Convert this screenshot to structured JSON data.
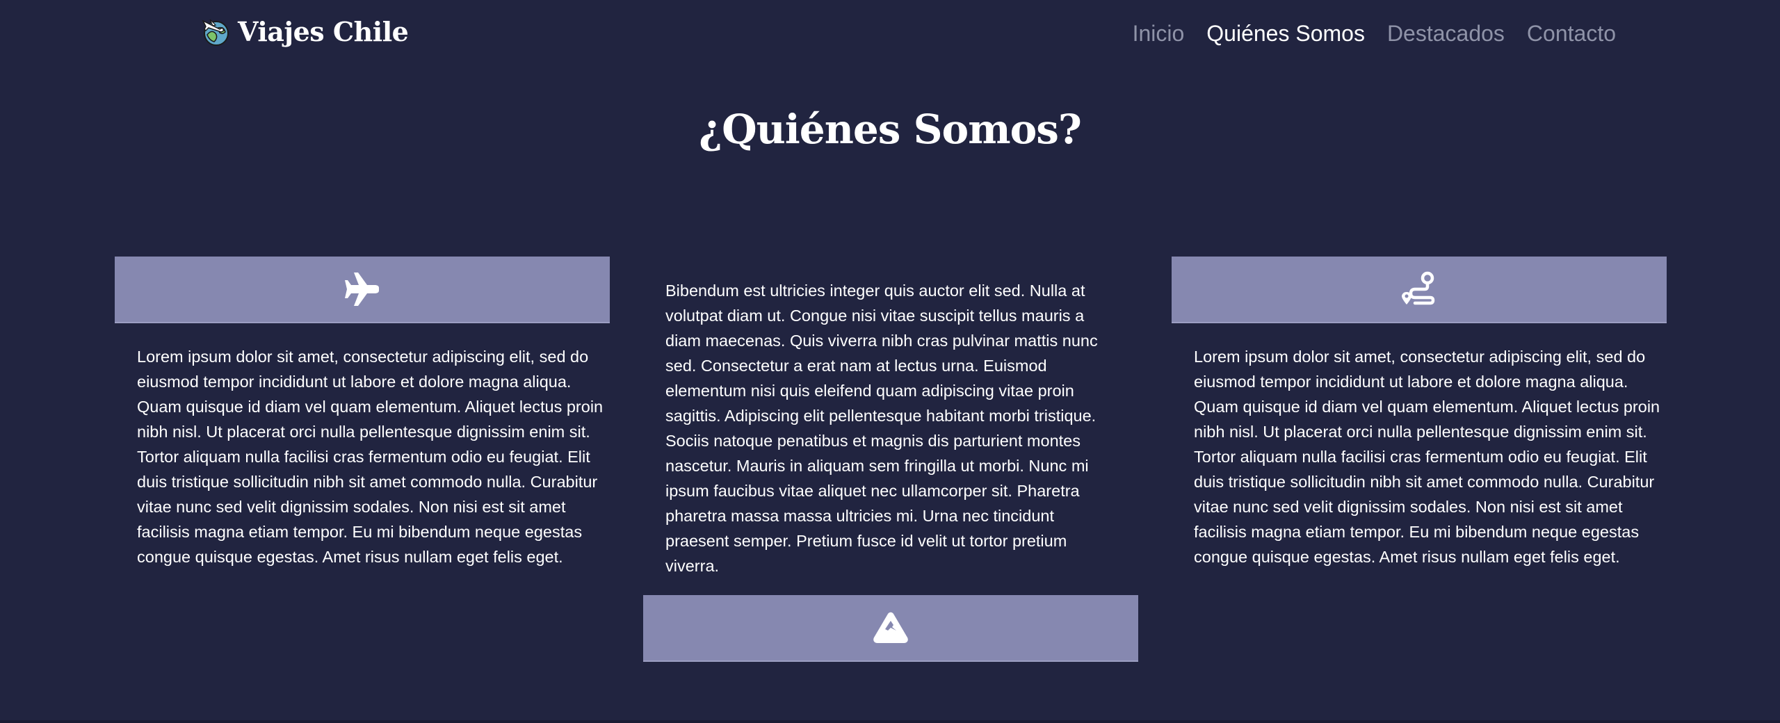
{
  "nav": {
    "brand": "Viajes Chile",
    "links": [
      {
        "label": "Inicio",
        "active": false
      },
      {
        "label": "Quiénes Somos",
        "active": true
      },
      {
        "label": "Destacados",
        "active": false
      },
      {
        "label": "Contacto",
        "active": false
      }
    ]
  },
  "section": {
    "title": "¿Quiénes Somos?"
  },
  "cards": {
    "left": {
      "icon": "airplane-icon",
      "text": "Lorem ipsum dolor sit amet, consectetur adipiscing elit, sed do eiusmod tempor incididunt ut labore et dolore magna aliqua. Quam quisque id diam vel quam elementum. Aliquet lectus proin nibh nisl. Ut placerat orci nulla pellentesque dignissim enim sit. Tortor aliquam nulla facilisi cras fermentum odio eu feugiat. Elit duis tristique sollicitudin nibh sit amet commodo nulla. Curabitur vitae nunc sed velit dignissim sodales. Non nisi est sit amet facilisis magna etiam tempor. Eu mi bibendum neque egestas congue quisque egestas. Amet risus nullam eget felis eget."
    },
    "middle": {
      "icon": "mountain-icon",
      "text": "Bibendum est ultricies integer quis auctor elit sed. Nulla at volutpat diam ut. Congue nisi vitae suscipit tellus mauris a diam maecenas. Quis viverra nibh cras pulvinar mattis nunc sed. Consectetur a erat nam at lectus urna. Euismod elementum nisi quis eleifend quam adipiscing vitae proin sagittis. Adipiscing elit pellentesque habitant morbi tristique. Sociis natoque penatibus et magnis dis parturient montes nascetur. Mauris in aliquam sem fringilla ut morbi. Nunc mi ipsum faucibus vitae aliquet nec ullamcorper sit. Pharetra pharetra massa massa ultricies mi. Urna nec tincidunt praesent semper. Pretium fusce id velit ut tortor pretium viverra."
    },
    "right": {
      "icon": "route-icon",
      "text": "Lorem ipsum dolor sit amet, consectetur adipiscing elit, sed do eiusmod tempor incididunt ut labore et dolore magna aliqua. Quam quisque id diam vel quam elementum. Aliquet lectus proin nibh nisl. Ut placerat orci nulla pellentesque dignissim enim sit. Tortor aliquam nulla facilisi cras fermentum odio eu feugiat. Elit duis tristique sollicitudin nibh sit amet commodo nulla. Curabitur vitae nunc sed velit dignissim sodales. Non nisi est sit amet facilisis magna etiam tempor. Eu mi bibendum neque egestas congue quisque egestas. Amet risus nullam eget felis eget."
    }
  },
  "colors": {
    "background": "#212440",
    "card_accent": "#8688b0",
    "nav_inactive": "#8f93a8",
    "nav_active": "#ffffff"
  }
}
